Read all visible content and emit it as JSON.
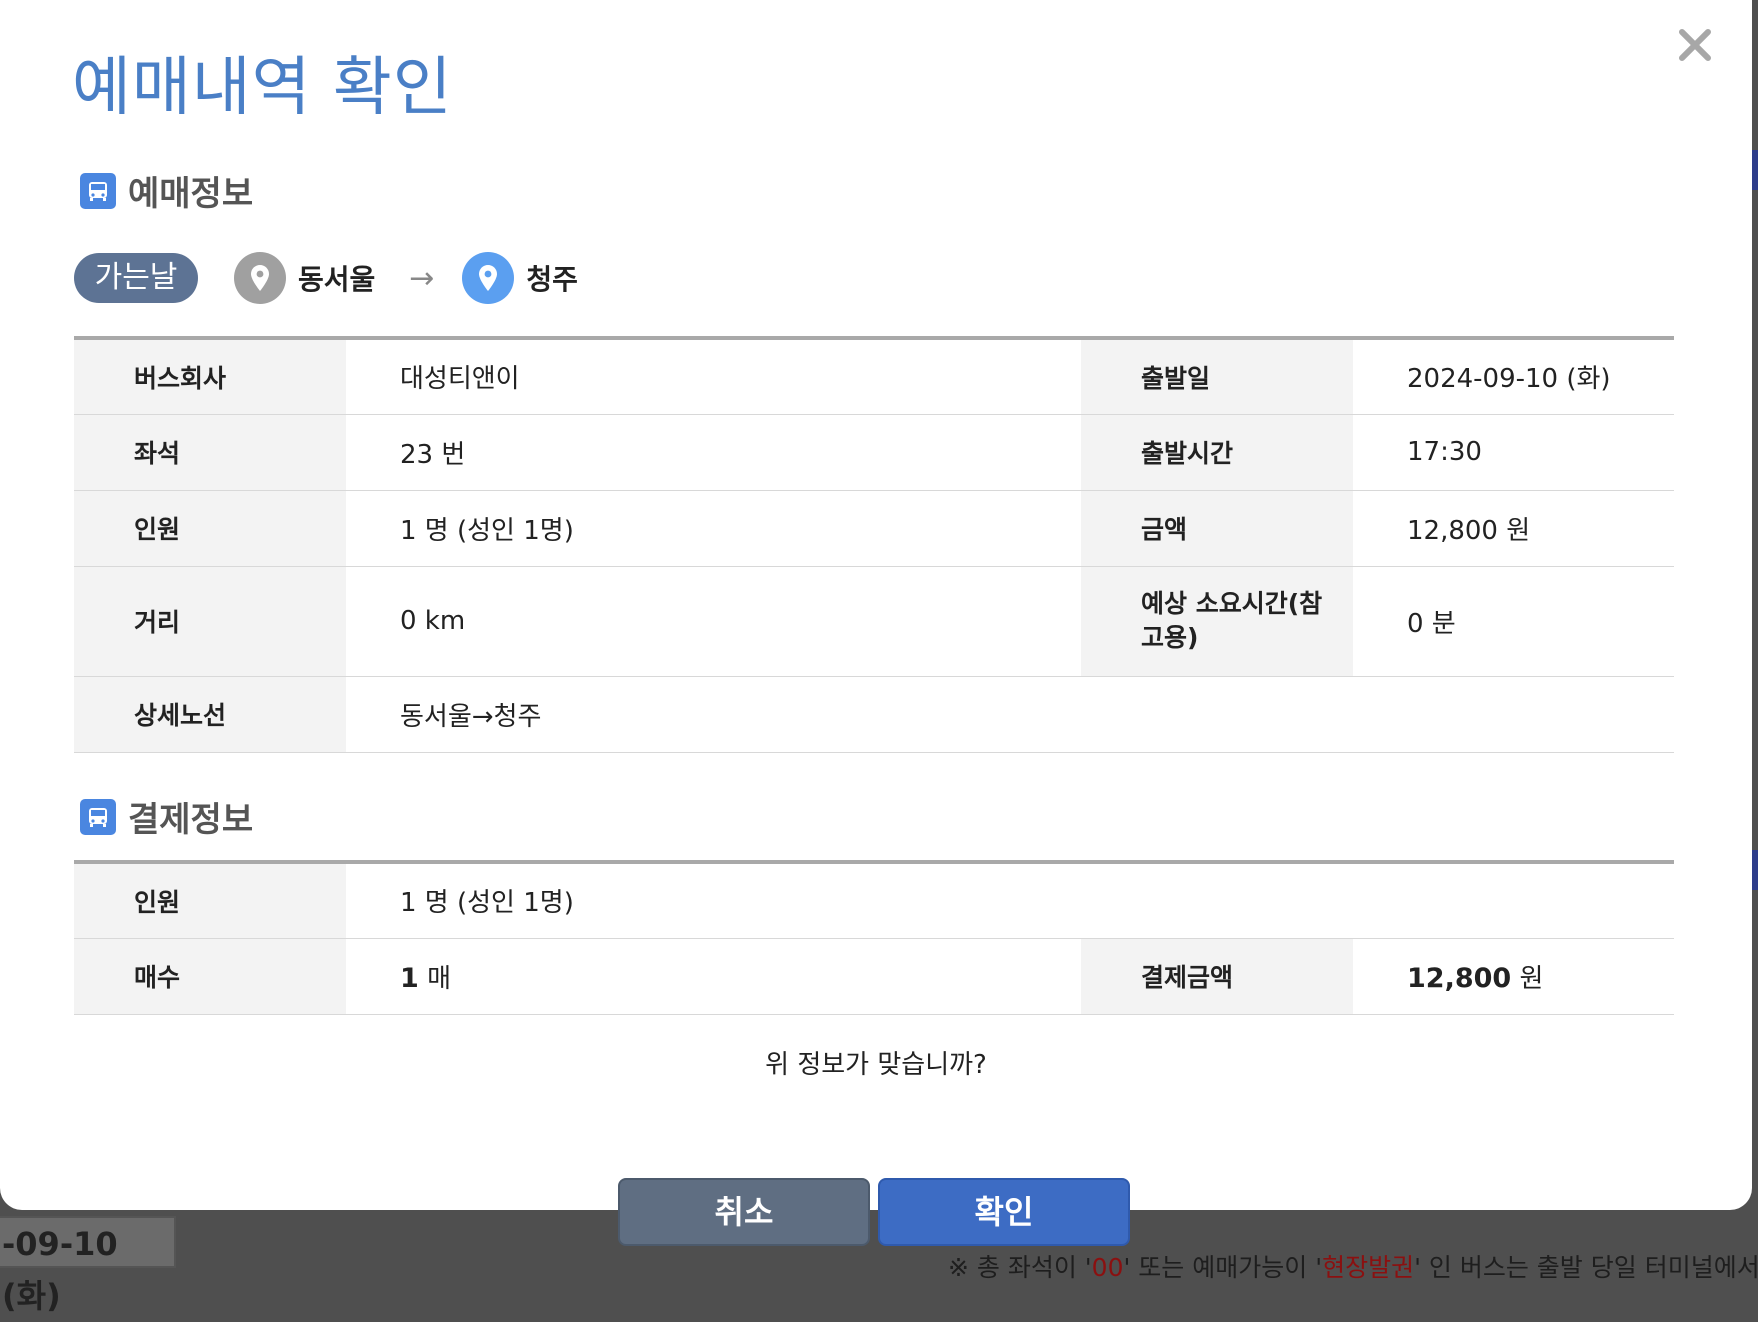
{
  "background": {
    "date_text": "-09-10 (화)",
    "notice_prefix": "※ 총 좌석이 '",
    "notice_red1": "00",
    "notice_mid": "' 또는 예매가능이 '",
    "notice_red2": "현장발권",
    "notice_suffix": "' 인 버스는 출발 당일 터미널에서 구"
  },
  "modal": {
    "title": "예매내역 확인",
    "close_icon": "close-icon",
    "booking_section": {
      "icon": "bus-icon",
      "label": "예매정보"
    },
    "route": {
      "day_badge": "가는날",
      "from": "동서울",
      "arrow": "→",
      "to": "청주",
      "from_pin_color": "#a0a0a0",
      "to_pin_color": "#5b9ff0"
    },
    "booking_rows": {
      "company_label": "버스회사",
      "company": "대성티앤이",
      "date_label": "출발일",
      "date": "2024-09-10 (화)",
      "seat_label": "좌석",
      "seat": "23 번",
      "time_label": "출발시간",
      "time": "17:30",
      "people_label": "인원",
      "people": "1 명 (성인 1명)",
      "price_label": "금액",
      "price": "12,800 원",
      "distance_label": "거리",
      "distance": "0 km",
      "duration_label": "예상 소요시간(참고용)",
      "duration": "0 분",
      "route_label": "상세노선",
      "route_detail": "동서울→청주"
    },
    "payment_section": {
      "icon": "bus-icon",
      "label": "결제정보"
    },
    "payment_rows": {
      "people_label": "인원",
      "people": "1 명 (성인 1명)",
      "count_label": "매수",
      "count_num": "1",
      "count_unit": "매",
      "total_label": "결제금액",
      "total_num": "12,800",
      "total_unit": "원"
    },
    "question": "위 정보가 맞습니까?",
    "buttons": {
      "cancel": "취소",
      "confirm": "확인"
    },
    "colors": {
      "title": "#4a7fc6",
      "confirm": "#3d6cc4",
      "cancel": "#5f6e82",
      "badge": "#5d7394"
    }
  }
}
